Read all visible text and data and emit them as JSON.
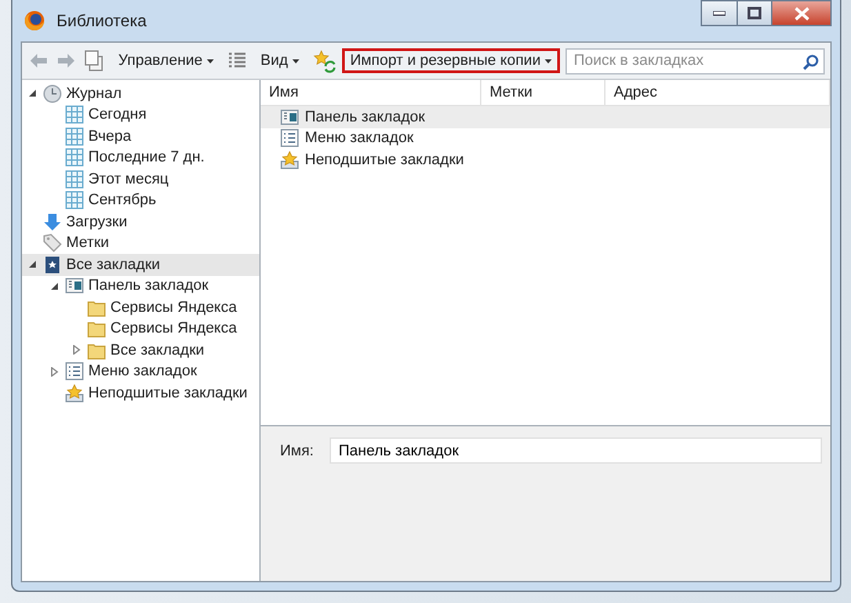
{
  "window": {
    "title": "Библиотека"
  },
  "toolbar": {
    "back": {
      "disabled": true
    },
    "forward": {
      "disabled": true
    },
    "menus": [
      {
        "kind": "organize",
        "label": "Управление",
        "highlighted": false
      },
      {
        "kind": "view",
        "label": "Вид",
        "highlighted": false
      },
      {
        "kind": "import",
        "label": "Импорт и резервные копии",
        "highlighted": true
      }
    ],
    "search": {
      "placeholder": "Поиск в закладках"
    }
  },
  "tree": [
    {
      "kind": "clock",
      "label": "Журнал",
      "expanded": true,
      "selected": false,
      "children": [
        {
          "kind": "calendar",
          "label": "Сегодня",
          "selected": false
        },
        {
          "kind": "calendar",
          "label": "Вчера",
          "selected": false
        },
        {
          "kind": "calendar",
          "label": "Последние 7 дн.",
          "selected": false
        },
        {
          "kind": "calendar",
          "label": "Этот месяц",
          "selected": false
        },
        {
          "kind": "calendar",
          "label": "Сентябрь",
          "selected": false
        }
      ]
    },
    {
      "kind": "download",
      "label": "Загрузки",
      "selected": false
    },
    {
      "kind": "tag",
      "label": "Метки",
      "selected": false
    },
    {
      "kind": "star",
      "label": "Все закладки",
      "expanded": true,
      "selected": true,
      "children": [
        {
          "kind": "toolbar",
          "label": "Панель закладок",
          "expanded": true,
          "selected": false,
          "children": [
            {
              "kind": "folder",
              "label": "Сервисы Яндекса",
              "selected": false
            },
            {
              "kind": "folder",
              "label": "Сервисы Яндекса",
              "selected": false
            },
            {
              "kind": "folder",
              "label": "Все закладки",
              "expanded": false,
              "selected": false
            }
          ]
        },
        {
          "kind": "menu",
          "label": "Меню закладок",
          "expanded": false,
          "selected": false
        },
        {
          "kind": "unsorted",
          "label": "Неподшитые закладки",
          "selected": false
        }
      ]
    }
  ],
  "table": {
    "columns": [
      "Имя",
      "Метки",
      "Адрес"
    ],
    "rows": [
      {
        "kind": "toolbar",
        "name": "Панель закладок",
        "selected": true
      },
      {
        "kind": "menu",
        "name": "Меню закладок",
        "selected": false
      },
      {
        "kind": "unsorted",
        "name": "Неподшитые закладки",
        "selected": false
      }
    ]
  },
  "details": {
    "name_label": "Имя:",
    "name_value": "Панель закладок"
  }
}
